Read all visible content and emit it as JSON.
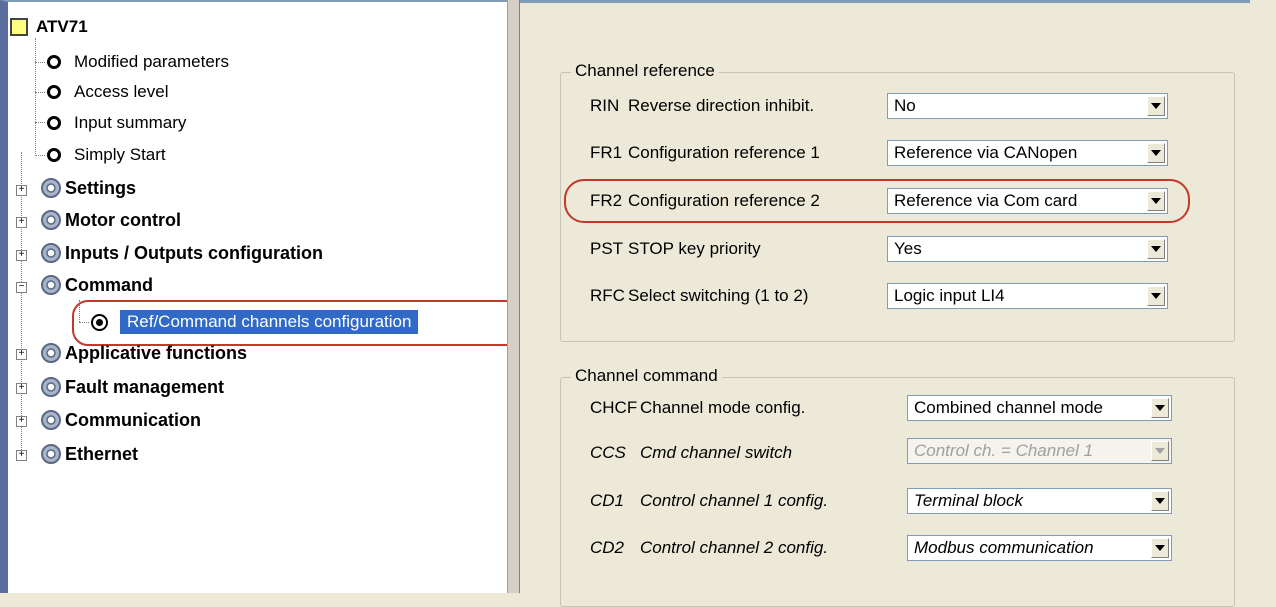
{
  "tree": {
    "root": "ATV71",
    "items": [
      {
        "label": "Modified parameters"
      },
      {
        "label": "Access level"
      },
      {
        "label": "Input summary"
      },
      {
        "label": "Simply Start"
      }
    ],
    "categories": [
      {
        "label": "Settings"
      },
      {
        "label": "Motor control"
      },
      {
        "label": "Inputs / Outputs configuration"
      },
      {
        "label": "Command"
      },
      {
        "label": "Applicative functions"
      },
      {
        "label": "Fault management"
      },
      {
        "label": "Communication"
      },
      {
        "label": "Ethernet"
      }
    ],
    "selected": "Ref/Command channels configuration",
    "expander_plus": "+",
    "expander_minus": "−"
  },
  "channel_reference": {
    "title": "Channel reference",
    "rows": [
      {
        "code": "RIN",
        "label": "Reverse direction inhibit.",
        "value": "No"
      },
      {
        "code": "FR1",
        "label": "Configuration reference 1",
        "value": "Reference via CANopen"
      },
      {
        "code": "FR2",
        "label": "Configuration reference 2",
        "value": "Reference via Com card"
      },
      {
        "code": "PST",
        "label": "STOP key priority",
        "value": "Yes"
      },
      {
        "code": "RFC",
        "label": "Select switching (1 to 2)",
        "value": "Logic input LI4"
      }
    ]
  },
  "channel_command": {
    "title": "Channel command",
    "rows": [
      {
        "code": "CHCF",
        "label": "Channel mode config.",
        "value": "Combined channel mode"
      },
      {
        "code": "CCS",
        "label": "Cmd channel switch",
        "value": "Control ch. = Channel 1"
      },
      {
        "code": "CD1",
        "label": "Control channel 1 config.",
        "value": "Terminal block"
      },
      {
        "code": "CD2",
        "label": "Control channel 2 config.",
        "value": "Modbus communication"
      }
    ]
  },
  "colors": {
    "highlight": "#c0392b",
    "selection": "#316ac5"
  }
}
